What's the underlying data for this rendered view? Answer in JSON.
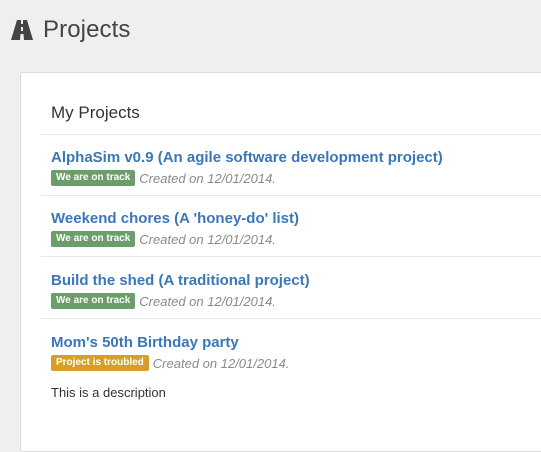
{
  "header": {
    "title": "Projects",
    "icon": "road-icon"
  },
  "panel": {
    "heading": "My Projects"
  },
  "projects": [
    {
      "name": "AlphaSim v0.9 (An agile software development project)",
      "status": "We are on track",
      "status_color": "#6b9e6b",
      "created": "Created on 12/01/2014.",
      "description": ""
    },
    {
      "name": "Weekend chores (A 'honey-do' list)",
      "status": "We are on track",
      "status_color": "#6b9e6b",
      "created": "Created on 12/01/2014.",
      "description": ""
    },
    {
      "name": "Build the shed (A traditional project)",
      "status": "We are on track",
      "status_color": "#6b9e6b",
      "created": "Created on 12/01/2014.",
      "description": ""
    },
    {
      "name": "Mom's 50th Birthday party",
      "status": "Project is troubled",
      "status_color": "#d6a028",
      "created": "Created on 12/01/2014.",
      "description": "This is a description"
    }
  ]
}
